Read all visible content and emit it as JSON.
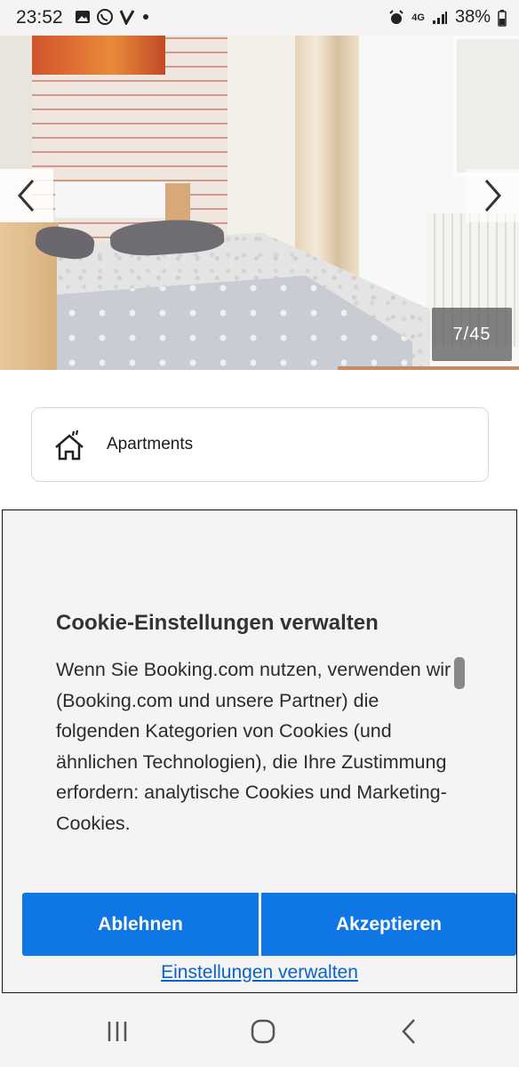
{
  "status_bar": {
    "time": "23:52",
    "network": "4G",
    "battery": "38%",
    "icons": [
      "gallery-icon",
      "viber-icon",
      "v-icon",
      "dot-icon",
      "alarm-icon",
      "signal-icon",
      "battery-icon"
    ]
  },
  "gallery": {
    "counter": "7/45",
    "prev_icon": "chevron-left-icon",
    "next_icon": "chevron-right-icon"
  },
  "property": {
    "icon": "house-icon",
    "type_label": "Apartments"
  },
  "cookie_dialog": {
    "title": "Cookie-Einstellungen verwalten",
    "body": "Wenn Sie Booking.com nutzen, verwenden wir (Booking.com und unsere Partner) die folgenden Kategorien von Cookies (und ähnlichen Technologien), die Ihre Zustimmung erfordern: analytische Cookies und Marketing-Cookies.",
    "reject_label": "Ablehnen",
    "accept_label": "Akzeptieren",
    "manage_label": "Einstellungen verwalten",
    "accent_color": "#0f76e6"
  },
  "system_nav": {
    "recents_icon": "recents-icon",
    "home_icon": "home-icon",
    "back_icon": "back-icon"
  }
}
